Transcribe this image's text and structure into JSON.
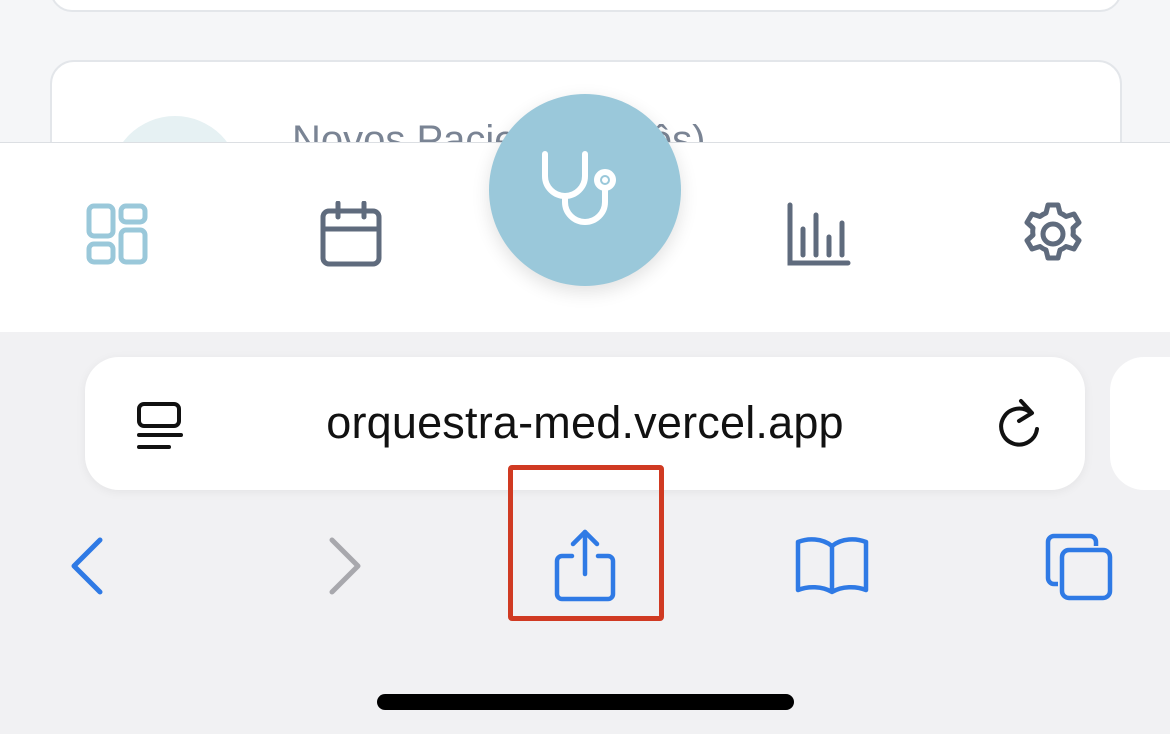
{
  "stat_card": {
    "label": "Novos Pacientes (Mês)"
  },
  "bottom_nav": {
    "items": [
      {
        "icon": "dashboard-grid-icon",
        "active": true
      },
      {
        "icon": "calendar-icon",
        "active": false
      },
      {
        "icon": "stethoscope-icon",
        "active": false
      },
      {
        "icon": "bar-chart-icon",
        "active": false
      },
      {
        "icon": "settings-gear-icon",
        "active": false
      }
    ],
    "colors": {
      "active": "#9ac8da",
      "inactive": "#5f6b7d",
      "fab": "#9ac8da"
    }
  },
  "browser": {
    "url": "orquestra-med.vercel.app",
    "icons": {
      "page_menu": "page-menu-icon",
      "reload": "reload-icon",
      "back": "back-chevron-icon",
      "forward": "forward-chevron-icon",
      "share": "share-icon",
      "bookmarks": "bookmarks-book-icon",
      "tabs": "tabs-icon"
    },
    "accent": "#2f7ae5",
    "forward_enabled": false
  },
  "annotation": {
    "highlight_target": "share-icon",
    "highlight_color": "#d03a22"
  }
}
